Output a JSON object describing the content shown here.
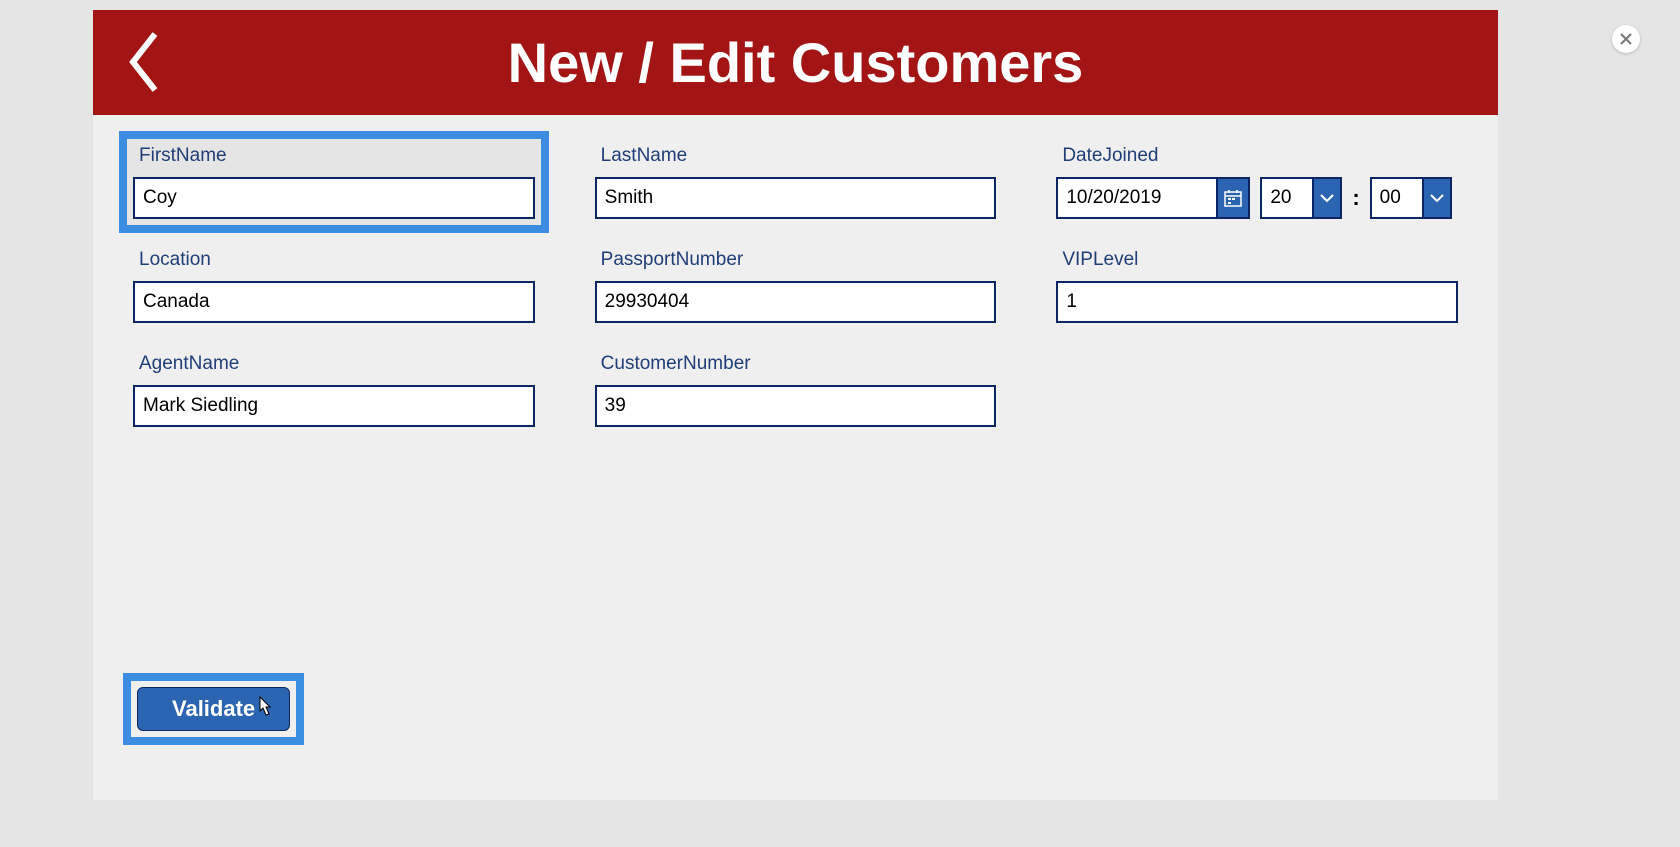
{
  "header": {
    "title": "New / Edit Customers"
  },
  "fields": {
    "firstName": {
      "label": "FirstName",
      "value": "Coy"
    },
    "lastName": {
      "label": "LastName",
      "value": "Smith"
    },
    "dateJoined": {
      "label": "DateJoined",
      "date": "10/20/2019",
      "hour": "20",
      "minute": "00",
      "separator": ":"
    },
    "location": {
      "label": "Location",
      "value": "Canada"
    },
    "passportNumber": {
      "label": "PassportNumber",
      "value": "29930404"
    },
    "vipLevel": {
      "label": "VIPLevel",
      "value": "1"
    },
    "agentName": {
      "label": "AgentName",
      "value": "Mark Siedling"
    },
    "customerNumber": {
      "label": "CustomerNumber",
      "value": "39"
    }
  },
  "buttons": {
    "validate": "Validate"
  }
}
